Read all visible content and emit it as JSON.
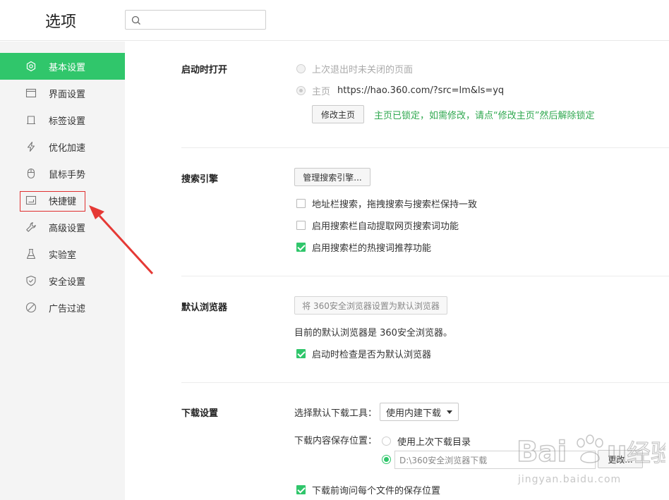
{
  "header": {
    "title": "选项",
    "search_placeholder": ""
  },
  "sidebar": {
    "items": [
      {
        "label": "基本设置",
        "icon": "settings-gear-icon",
        "active": true
      },
      {
        "label": "界面设置",
        "icon": "window-icon"
      },
      {
        "label": "标签设置",
        "icon": "tab-icon"
      },
      {
        "label": "优化加速",
        "icon": "lightning-icon"
      },
      {
        "label": "鼠标手势",
        "icon": "mouse-icon"
      },
      {
        "label": "快捷键",
        "icon": "keyboard-shortcut-icon"
      },
      {
        "label": "高级设置",
        "icon": "wrench-icon"
      },
      {
        "label": "实验室",
        "icon": "flask-icon"
      },
      {
        "label": "安全设置",
        "icon": "shield-icon"
      },
      {
        "label": "广告过滤",
        "icon": "block-icon"
      }
    ]
  },
  "startup": {
    "title": "启动时打开",
    "option_restore": "上次退出时未关闭的页面",
    "option_home_label": "主页",
    "home_url": "https://hao.360.com/?src=lm&ls=yq",
    "edit_home_button": "修改主页",
    "locked_note": "主页已锁定，如需修改，请点“修改主页”然后解除锁定"
  },
  "search_engine": {
    "title": "搜索引擎",
    "manage_button": "管理搜索引擎...",
    "options": [
      {
        "label": "地址栏搜索，拖拽搜索与搜索栏保持一致",
        "checked": false
      },
      {
        "label": "启用搜索栏自动提取网页搜索词功能",
        "checked": false
      },
      {
        "label": "启用搜索栏的热搜词推荐功能",
        "checked": true
      }
    ]
  },
  "default_browser": {
    "title": "默认浏览器",
    "set_default_button": "将 360安全浏览器设置为默认浏览器",
    "current_status": "目前的默认浏览器是 360安全浏览器。",
    "check_on_startup": "启动时检查是否为默认浏览器",
    "check_on_startup_checked": true
  },
  "download": {
    "title": "下载设置",
    "tool_label": "选择默认下载工具：",
    "tool_selected": "使用内建下载",
    "location_label": "下载内容保存位置：",
    "option_last_dir": "使用上次下载目录",
    "path_value": "D:\\360安全浏览器下载",
    "change_button": "更改...",
    "ask_each_file": "下载前询问每个文件的保存位置",
    "ask_each_file_checked": true
  },
  "watermark": {
    "text": "jingyan.baidu.com"
  },
  "colors": {
    "accent": "#30c66b",
    "note": "#2fa84f",
    "highlight": "#e03030"
  }
}
